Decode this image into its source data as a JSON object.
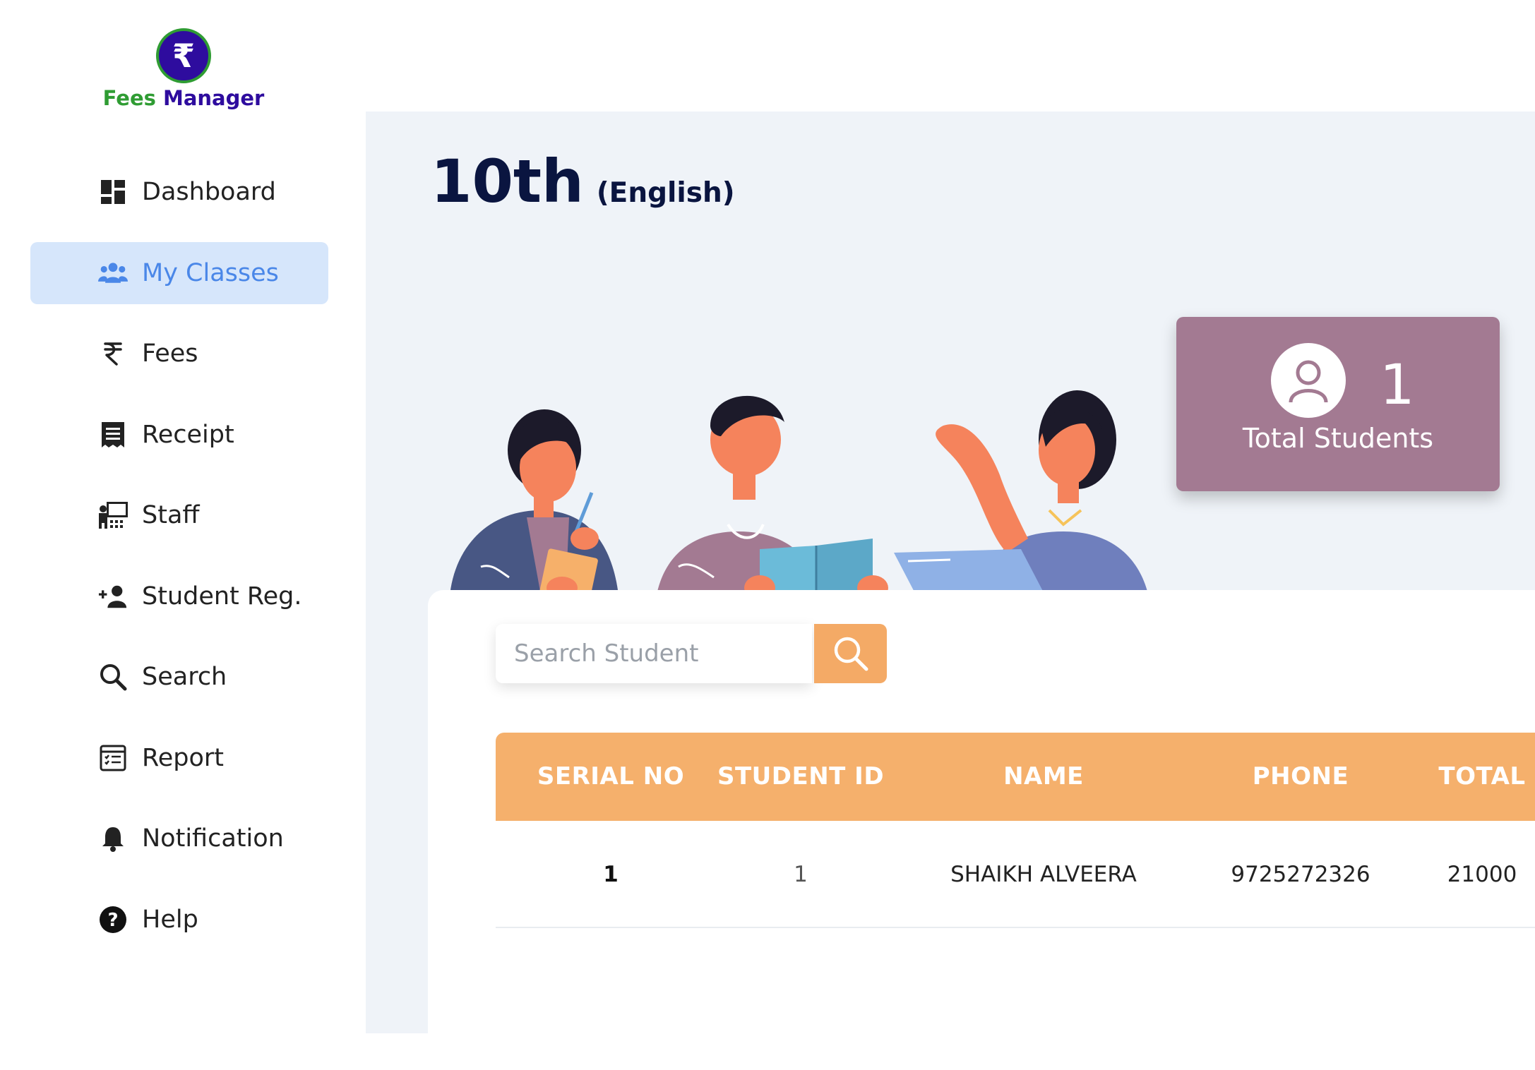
{
  "brand": {
    "symbol": "₹",
    "name_part1": "Fees",
    "name_part2": "Manager",
    "colors": {
      "primary": "#2e0c9e",
      "secondary": "#2f9c33"
    }
  },
  "sidebar": {
    "items": [
      {
        "label": "Dashboard",
        "icon": "dashboard-icon",
        "active": false
      },
      {
        "label": "My Classes",
        "icon": "users-icon",
        "active": true
      },
      {
        "label": "Fees",
        "icon": "rupee-icon",
        "active": false
      },
      {
        "label": "Receipt",
        "icon": "receipt-icon",
        "active": false
      },
      {
        "label": "Staff",
        "icon": "staff-icon",
        "active": false
      },
      {
        "label": "Student Reg.",
        "icon": "user-plus-icon",
        "active": false
      },
      {
        "label": "Search",
        "icon": "search-icon",
        "active": false
      },
      {
        "label": "Report",
        "icon": "report-icon",
        "active": false
      },
      {
        "label": "Notification",
        "icon": "bell-icon",
        "active": false
      },
      {
        "label": "Help",
        "icon": "help-icon",
        "active": false
      }
    ]
  },
  "page": {
    "title": "10th",
    "subtitle": "(English)"
  },
  "stats": {
    "total_students_count": "1",
    "total_students_label": "Total Students",
    "card_color": "#a37a92"
  },
  "search": {
    "placeholder": "Search Student",
    "value": "",
    "button_color": "#f4aa66"
  },
  "table": {
    "header_color": "#f5b06c",
    "columns": [
      "SERIAL NO",
      "STUDENT ID",
      "NAME",
      "PHONE",
      "TOTAL"
    ],
    "rows": [
      {
        "serial": "1",
        "student_id": "1",
        "name": "SHAIKH ALVEERA",
        "phone": "9725272326",
        "total": "21000"
      }
    ]
  }
}
